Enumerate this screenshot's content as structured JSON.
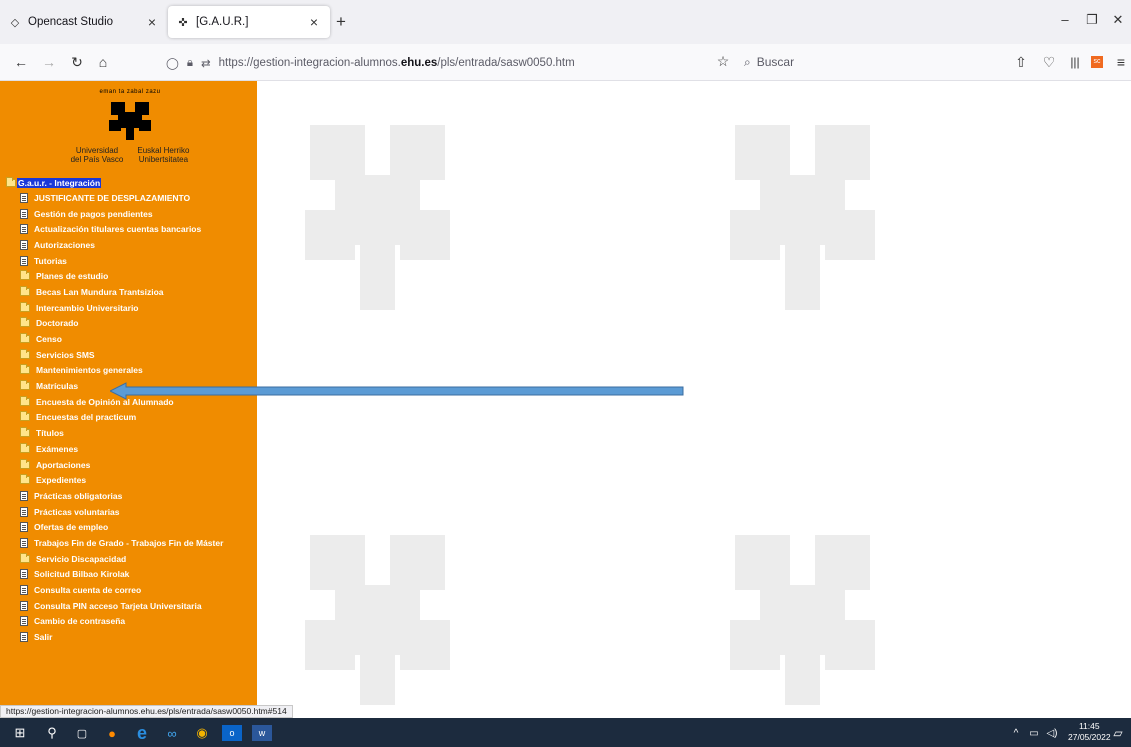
{
  "tabs": [
    {
      "icon": "opencast-icon",
      "glyph": "◇",
      "label": "Opencast Studio"
    },
    {
      "icon": "ehu-favicon",
      "glyph": "✜",
      "label": "[G.A.U.R.]"
    }
  ],
  "address_bar": {
    "url_prefix": "https://gestion-integracion-alumnos.",
    "url_domain": "ehu.es",
    "url_suffix": "/pls/entrada/sasw0050.htm"
  },
  "search": {
    "placeholder": "Buscar"
  },
  "logo": {
    "tagline": "eman ta zabal zazu",
    "left_caption_1": "Universidad",
    "left_caption_2": "del País Vasco",
    "right_caption_1": "Euskal Herriko",
    "right_caption_2": "Unibertsitatea"
  },
  "menu": {
    "root": "G.a.u.r. - Integración",
    "items": [
      {
        "label": "JUSTIFICANTE DE DESPLAZAMIENTO",
        "icon": "doc"
      },
      {
        "label": "Gestión de pagos pendientes",
        "icon": "doc"
      },
      {
        "label": "Actualización titulares cuentas bancarios",
        "icon": "doc"
      },
      {
        "label": "Autorizaciones",
        "icon": "doc"
      },
      {
        "label": "Tutorias",
        "icon": "doc"
      },
      {
        "label": "Planes de estudio",
        "icon": "folder"
      },
      {
        "label": "Becas Lan Mundura Trantsizioa",
        "icon": "folder"
      },
      {
        "label": "Intercambio Universitario",
        "icon": "folder"
      },
      {
        "label": "Doctorado",
        "icon": "folder"
      },
      {
        "label": "Censo",
        "icon": "folder"
      },
      {
        "label": "Servicios SMS",
        "icon": "folder"
      },
      {
        "label": "Mantenimientos generales",
        "icon": "folder"
      },
      {
        "label": "Matrículas",
        "icon": "folder"
      },
      {
        "label": "Encuesta de Opinión al Alumnado",
        "icon": "folder"
      },
      {
        "label": "Encuestas del practicum",
        "icon": "folder"
      },
      {
        "label": "Títulos",
        "icon": "folder"
      },
      {
        "label": "Exámenes",
        "icon": "folder"
      },
      {
        "label": "Aportaciones",
        "icon": "folder"
      },
      {
        "label": "Expedientes",
        "icon": "folder"
      },
      {
        "label": "Prácticas obligatorias",
        "icon": "doc"
      },
      {
        "label": "Prácticas voluntarias",
        "icon": "doc"
      },
      {
        "label": "Ofertas de empleo",
        "icon": "doc"
      },
      {
        "label": "Trabajos Fin de Grado - Trabajos Fin de Máster",
        "icon": "doc"
      },
      {
        "label": "Servicio Discapacidad",
        "icon": "folder"
      },
      {
        "label": "Solicitud Bilbao Kirolak",
        "icon": "doc"
      },
      {
        "label": "Consulta cuenta de correo",
        "icon": "doc"
      },
      {
        "label": "Consulta PIN acceso Tarjeta Universitaria",
        "icon": "doc"
      },
      {
        "label": "Cambio de contraseña",
        "icon": "doc"
      },
      {
        "label": "Salir",
        "icon": "doc"
      }
    ]
  },
  "status_url": "https://gestion-integracion-alumnos.ehu.es/pls/entrada/sasw0050.htm#514",
  "clock": {
    "time": "11:45",
    "date": "27/05/2022"
  },
  "colors": {
    "sidebar": "#f08c00",
    "arrow": "#5b9bd5",
    "taskbar": "#1c2b3e"
  }
}
